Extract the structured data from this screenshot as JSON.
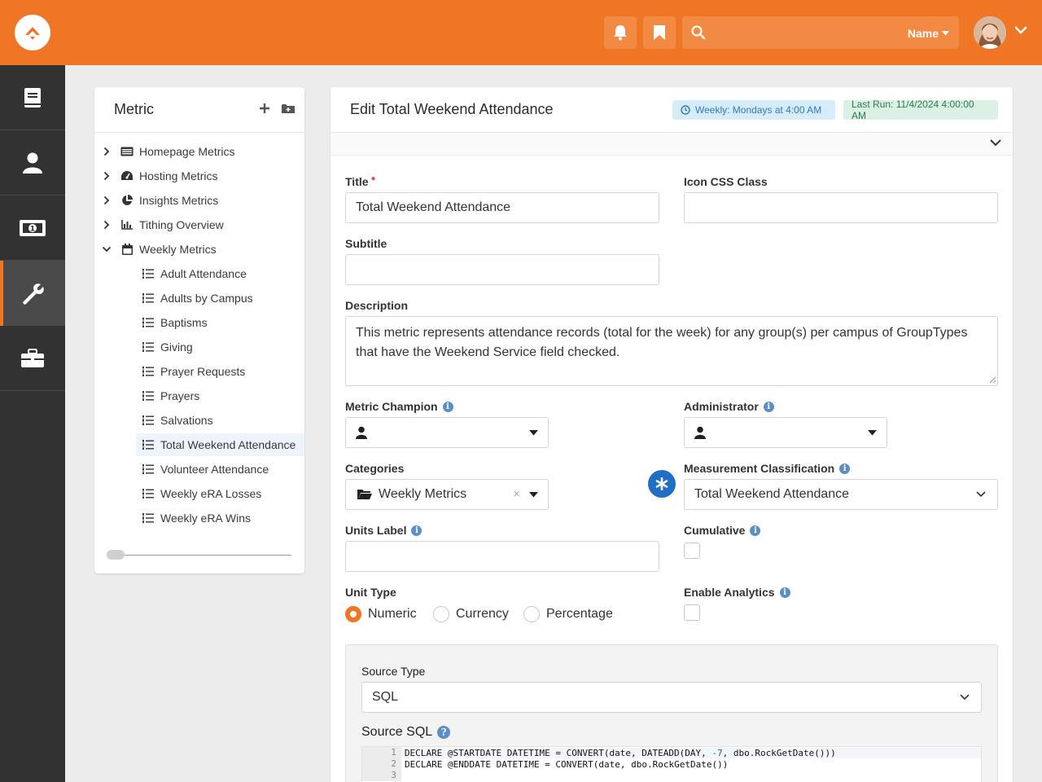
{
  "header": {
    "search_placeholder": "",
    "search_scope": "Name"
  },
  "tree": {
    "title": "Metric",
    "items": [
      {
        "label": "Homepage Metrics",
        "icon": "list-alt-icon",
        "expanded": false,
        "level": 0
      },
      {
        "label": "Hosting Metrics",
        "icon": "tachometer-icon",
        "expanded": false,
        "level": 0
      },
      {
        "label": "Insights Metrics",
        "icon": "pie-chart-icon",
        "expanded": false,
        "level": 0
      },
      {
        "label": "Tithing Overview",
        "icon": "bar-chart-icon",
        "expanded": false,
        "level": 0
      },
      {
        "label": "Weekly Metrics",
        "icon": "calendar-icon",
        "expanded": true,
        "level": 0
      },
      {
        "label": "Adult Attendance",
        "icon": "list-ol-icon",
        "level": 1
      },
      {
        "label": "Adults by Campus",
        "icon": "list-ol-icon",
        "level": 1
      },
      {
        "label": "Baptisms",
        "icon": "list-ol-icon",
        "level": 1
      },
      {
        "label": "Giving",
        "icon": "list-ol-icon",
        "level": 1
      },
      {
        "label": "Prayer Requests",
        "icon": "list-ol-icon",
        "level": 1
      },
      {
        "label": "Prayers",
        "icon": "list-ol-icon",
        "level": 1
      },
      {
        "label": "Salvations",
        "icon": "list-ol-icon",
        "level": 1
      },
      {
        "label": "Total Weekend Attendance",
        "icon": "list-ol-icon",
        "level": 1,
        "selected": true
      },
      {
        "label": "Volunteer Attendance",
        "icon": "list-ol-icon",
        "level": 1
      },
      {
        "label": "Weekly eRA Losses",
        "icon": "list-ol-icon",
        "level": 1
      },
      {
        "label": "Weekly eRA Wins",
        "icon": "list-ol-icon",
        "level": 1
      }
    ]
  },
  "editor": {
    "title": "Edit Total Weekend Attendance",
    "schedule_badge": "Weekly: Mondays at 4:00 AM",
    "last_run_badge": "Last Run: 11/4/2024 4:00:00 AM",
    "fields": {
      "title_label": "Title",
      "title_value": "Total Weekend Attendance",
      "icon_label": "Icon CSS Class",
      "icon_value": "",
      "subtitle_label": "Subtitle",
      "subtitle_value": "",
      "description_label": "Description",
      "description_value": "This metric represents attendance records (total for the week) for any group(s) per campus of GroupTypes that have the Weekend Service field checked.",
      "champion_label": "Metric Champion",
      "administrator_label": "Administrator",
      "categories_label": "Categories",
      "categories_value": "Weekly Metrics",
      "classification_label": "Measurement Classification",
      "classification_value": "Total Weekend Attendance",
      "units_label": "Units Label",
      "units_value": "",
      "cumulative_label": "Cumulative",
      "unit_type_label": "Unit Type",
      "unit_types": [
        "Numeric",
        "Currency",
        "Percentage"
      ],
      "unit_type_selected": "Numeric",
      "analytics_label": "Enable Analytics",
      "source_type_label": "Source Type",
      "source_type_value": "SQL",
      "source_sql_label": "Source SQL"
    },
    "code": [
      {
        "n": "1",
        "text_a": "DECLARE @STARTDATE DATETIME = CONVERT(date, DATEADD(DAY, ",
        "num": "-7",
        "text_b": ", dbo.RockGetDate()))"
      },
      {
        "n": "2",
        "text_a": "DECLARE @ENDDATE DATETIME = CONVERT(date, dbo.RockGetDate())",
        "num": "",
        "text_b": ""
      },
      {
        "n": "3",
        "text_a": "",
        "num": "",
        "text_b": ""
      }
    ]
  },
  "colors": {
    "brand": "#ee7625",
    "sidebar": "#323232",
    "accent_blue": "#1f6fc5"
  }
}
